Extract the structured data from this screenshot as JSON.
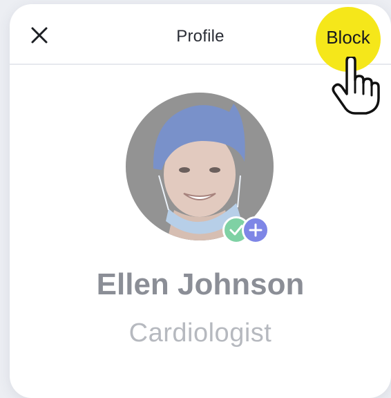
{
  "header": {
    "title": "Profile",
    "close_icon": "close-icon",
    "block_label": "Block",
    "highlight_color": "#f5e71a"
  },
  "profile": {
    "name": "Ellen Johnson",
    "specialty": "Cardiologist",
    "avatar_icon": "doctor-avatar",
    "badges": [
      {
        "icon": "check-icon",
        "color": "#7fd1a4"
      },
      {
        "icon": "plus-icon",
        "color": "#7e86e6"
      }
    ]
  },
  "cursor_icon": "hand-pointer-icon"
}
